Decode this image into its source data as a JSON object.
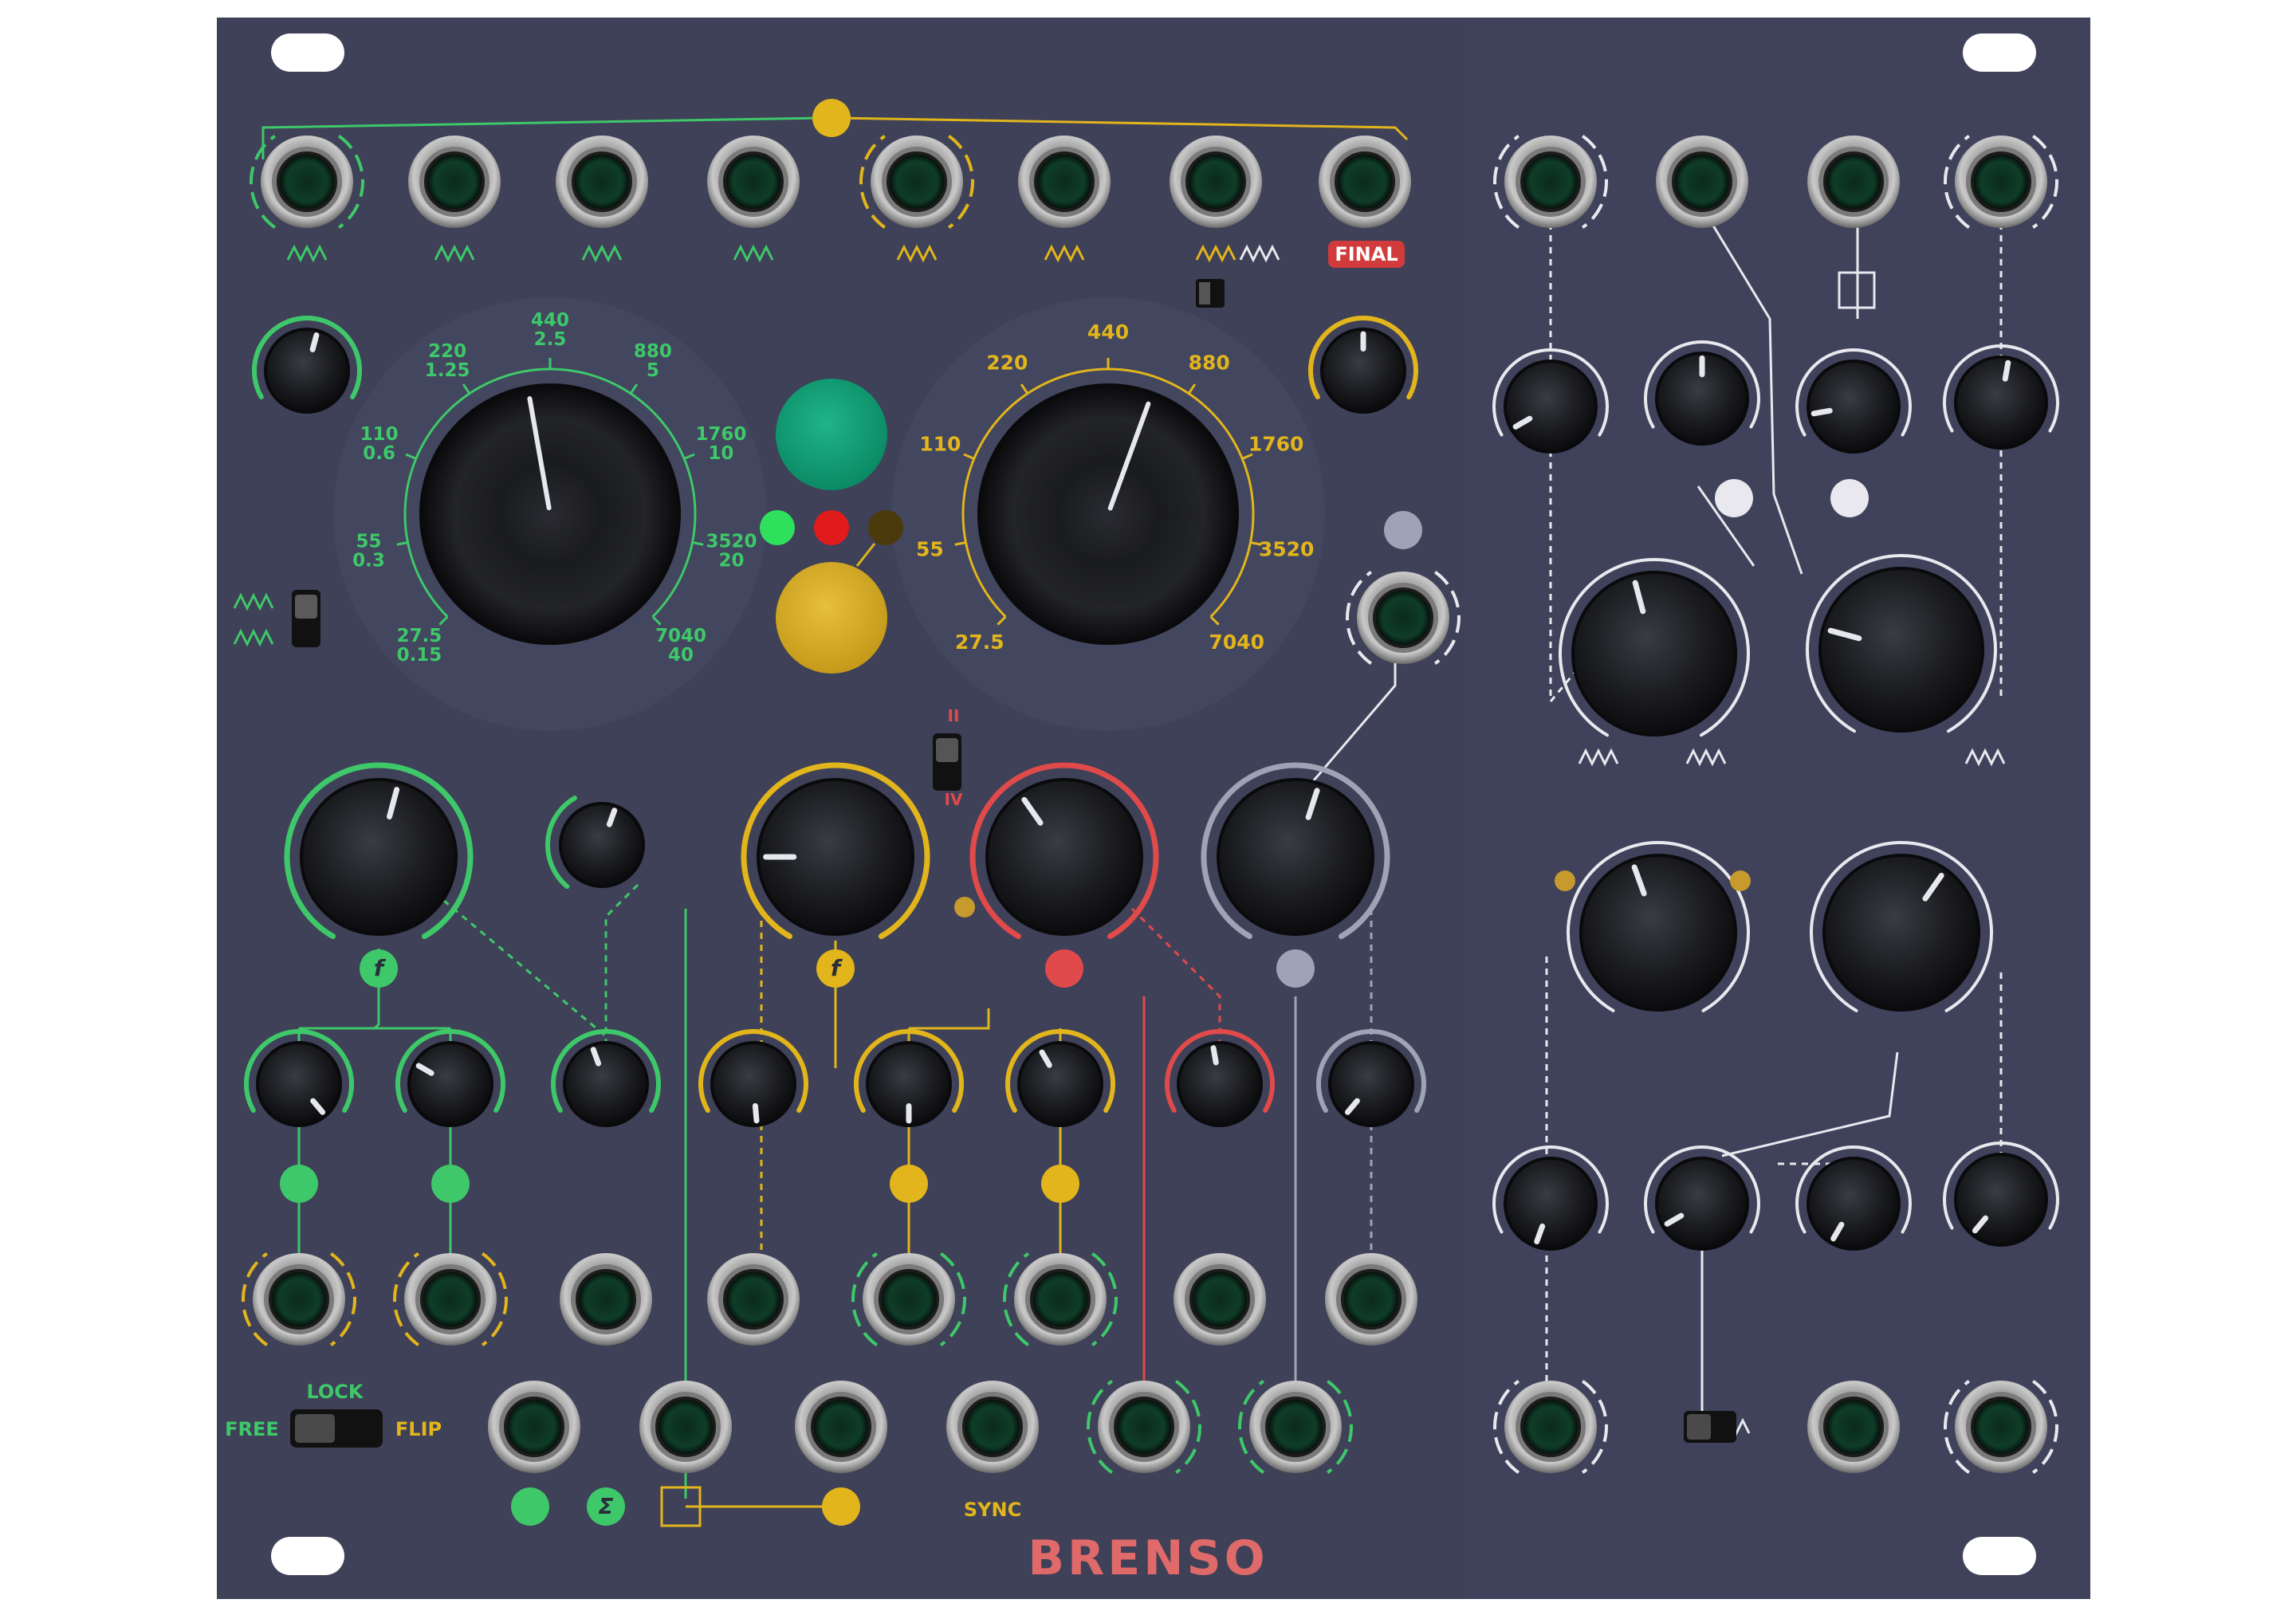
{
  "module": {
    "brand": "BRENSO",
    "colors": {
      "panel": "#3e4157",
      "green": "#3ec86a",
      "yellow": "#e2b51c",
      "red": "#e04a4a",
      "grey": "#9ea3b6",
      "white": "#e8e8ee",
      "knob": "#17181c"
    }
  },
  "left_osc": {
    "scale": [
      {
        "top": "27.5",
        "bottom": "0.15"
      },
      {
        "top": "55",
        "bottom": "0.3"
      },
      {
        "top": "110",
        "bottom": "0.6"
      },
      {
        "top": "220",
        "bottom": "1.25"
      },
      {
        "top": "440",
        "bottom": "2.5"
      },
      {
        "top": "880",
        "bottom": "5"
      },
      {
        "top": "1760",
        "bottom": "10"
      },
      {
        "top": "3520",
        "bottom": "20"
      },
      {
        "top": "7040",
        "bottom": "40"
      }
    ]
  },
  "right_osc": {
    "scale": [
      "27.5",
      "55",
      "110",
      "220",
      "440",
      "880",
      "1760",
      "3520",
      "7040"
    ]
  },
  "labels": {
    "final": "FINAL",
    "lock": "LOCK",
    "free": "FREE",
    "flip": "FLIP",
    "sync": "SYNC",
    "switch_ii": "II",
    "switch_iv": "IV",
    "f_symbol": "f",
    "sigma": "Σ"
  }
}
